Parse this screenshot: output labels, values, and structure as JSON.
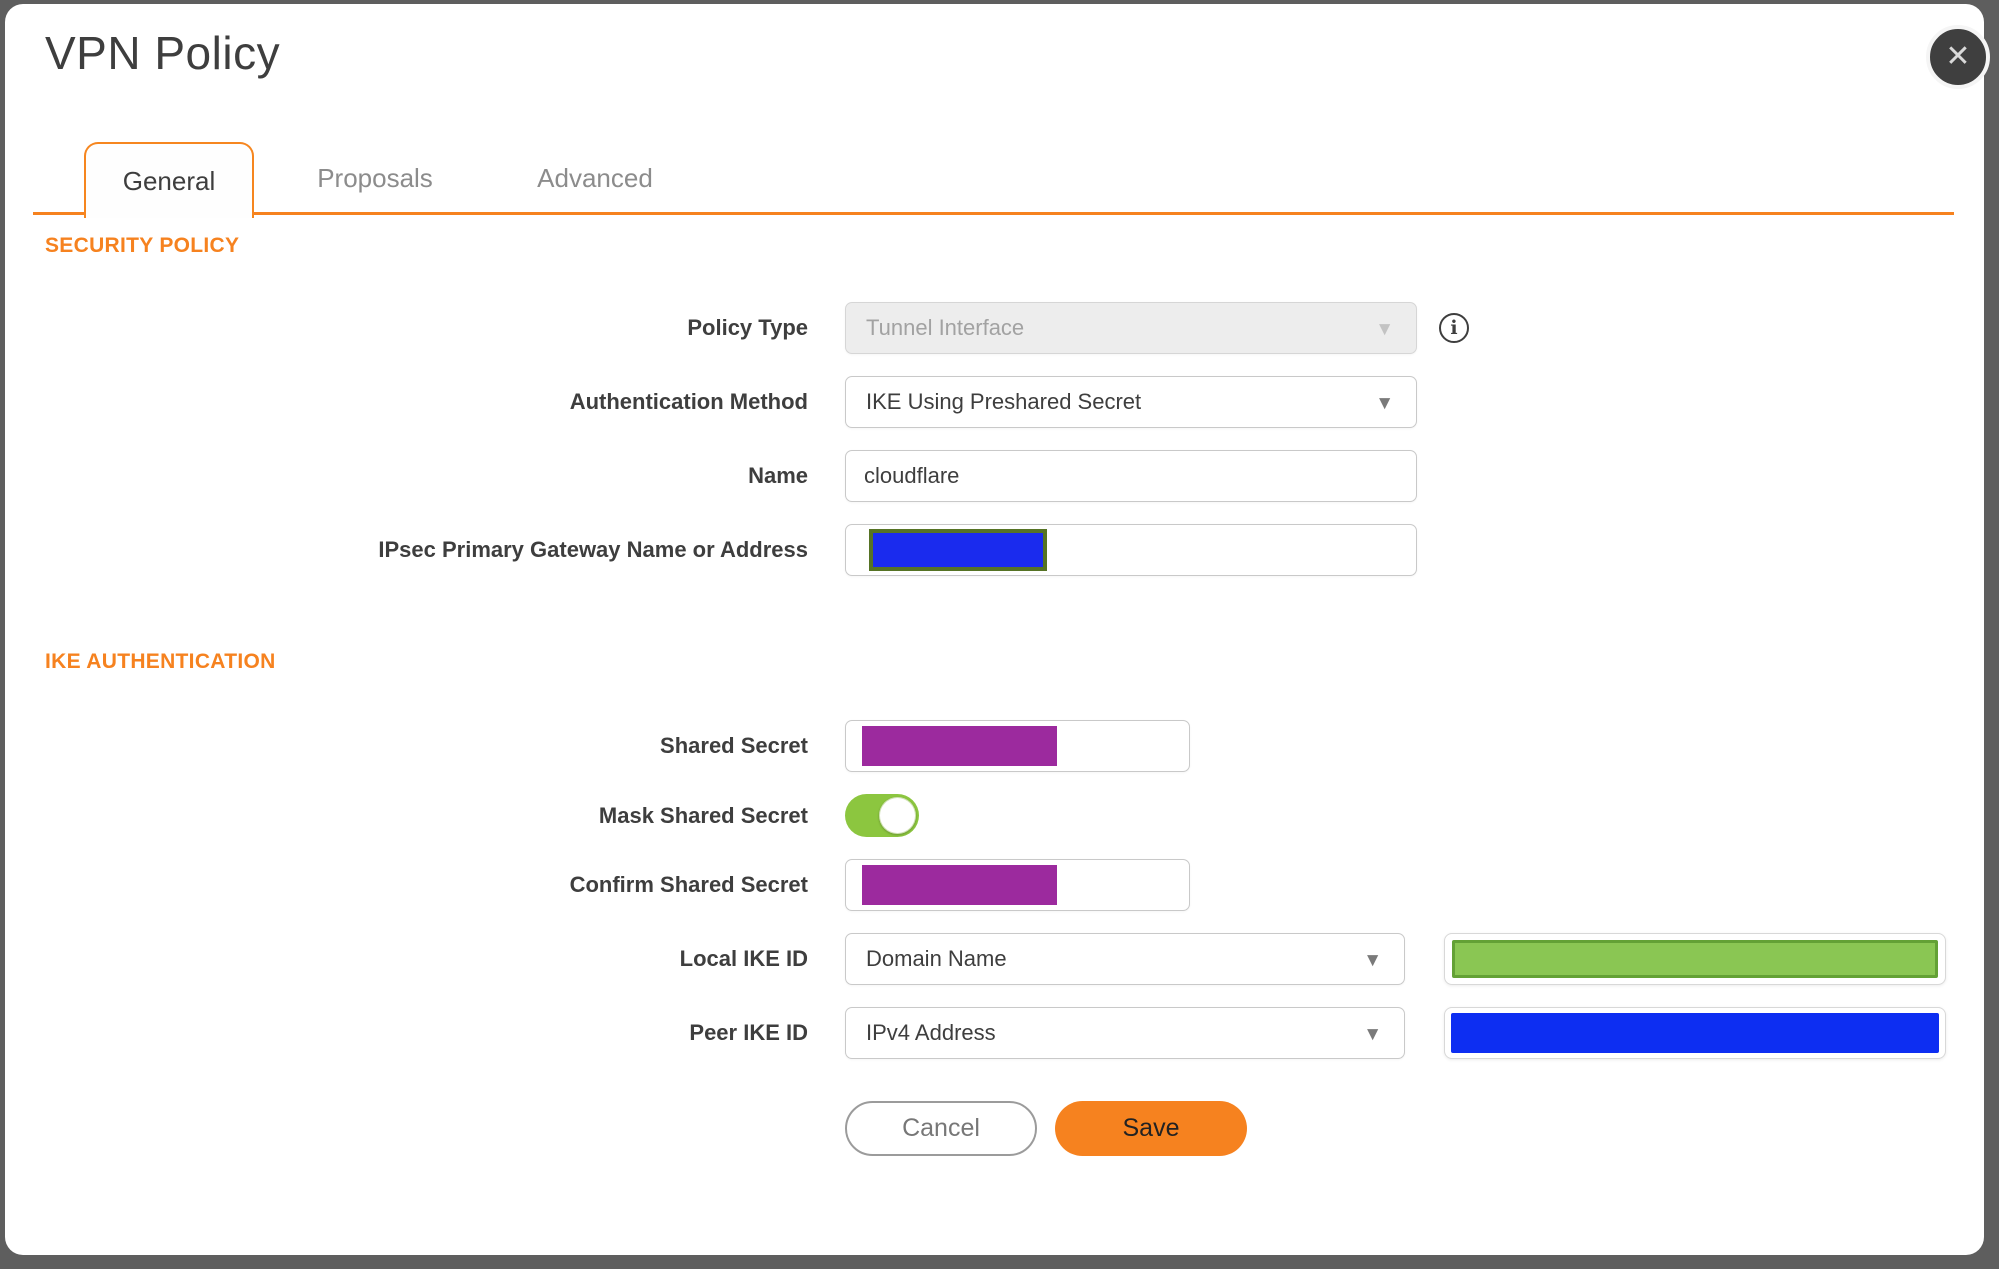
{
  "dialog": {
    "title": "VPN Policy"
  },
  "icons": {
    "close": "✕",
    "info": "i",
    "dropdown_caret": "▼"
  },
  "tabs": [
    {
      "label": "General",
      "active": true
    },
    {
      "label": "Proposals",
      "active": false
    },
    {
      "label": "Advanced",
      "active": false
    }
  ],
  "sections": {
    "security_policy": {
      "heading": "SECURITY POLICY"
    },
    "ike_authentication": {
      "heading": "IKE AUTHENTICATION"
    }
  },
  "fields": {
    "policy_type": {
      "label": "Policy Type",
      "value": "Tunnel Interface",
      "disabled": true
    },
    "authentication_method": {
      "label": "Authentication Method",
      "value": "IKE Using Preshared Secret"
    },
    "name": {
      "label": "Name",
      "value": "cloudflare"
    },
    "ipsec_gateway": {
      "label": "IPsec Primary Gateway Name or Address",
      "value": "",
      "redacted": true
    },
    "shared_secret": {
      "label": "Shared Secret",
      "value": "",
      "redacted": true
    },
    "mask_shared_secret": {
      "label": "Mask Shared Secret",
      "enabled": true
    },
    "confirm_shared_secret": {
      "label": "Confirm Shared Secret",
      "value": "",
      "redacted": true
    },
    "local_ike_id": {
      "label": "Local IKE ID",
      "value": "Domain Name",
      "extra_redacted": true
    },
    "peer_ike_id": {
      "label": "Peer IKE ID",
      "value": "IPv4 Address",
      "extra_redacted": true
    }
  },
  "buttons": {
    "cancel": "Cancel",
    "save": "Save"
  },
  "colors": {
    "accent_orange": "#F6821F",
    "toggle_green": "#8CC63F",
    "redaction_purple": "#9C2A9E",
    "redaction_blue": "#0D2EF2",
    "redaction_green_fill": "#8AC653",
    "redaction_green_border": "#63A135",
    "redaction_gateway_blue": "#1A2BEE",
    "redaction_gateway_border": "#567324",
    "backdrop_gray": "#5E5E5E",
    "text_dark": "#3E3E3E",
    "text_disabled": "#A2A2A2"
  }
}
